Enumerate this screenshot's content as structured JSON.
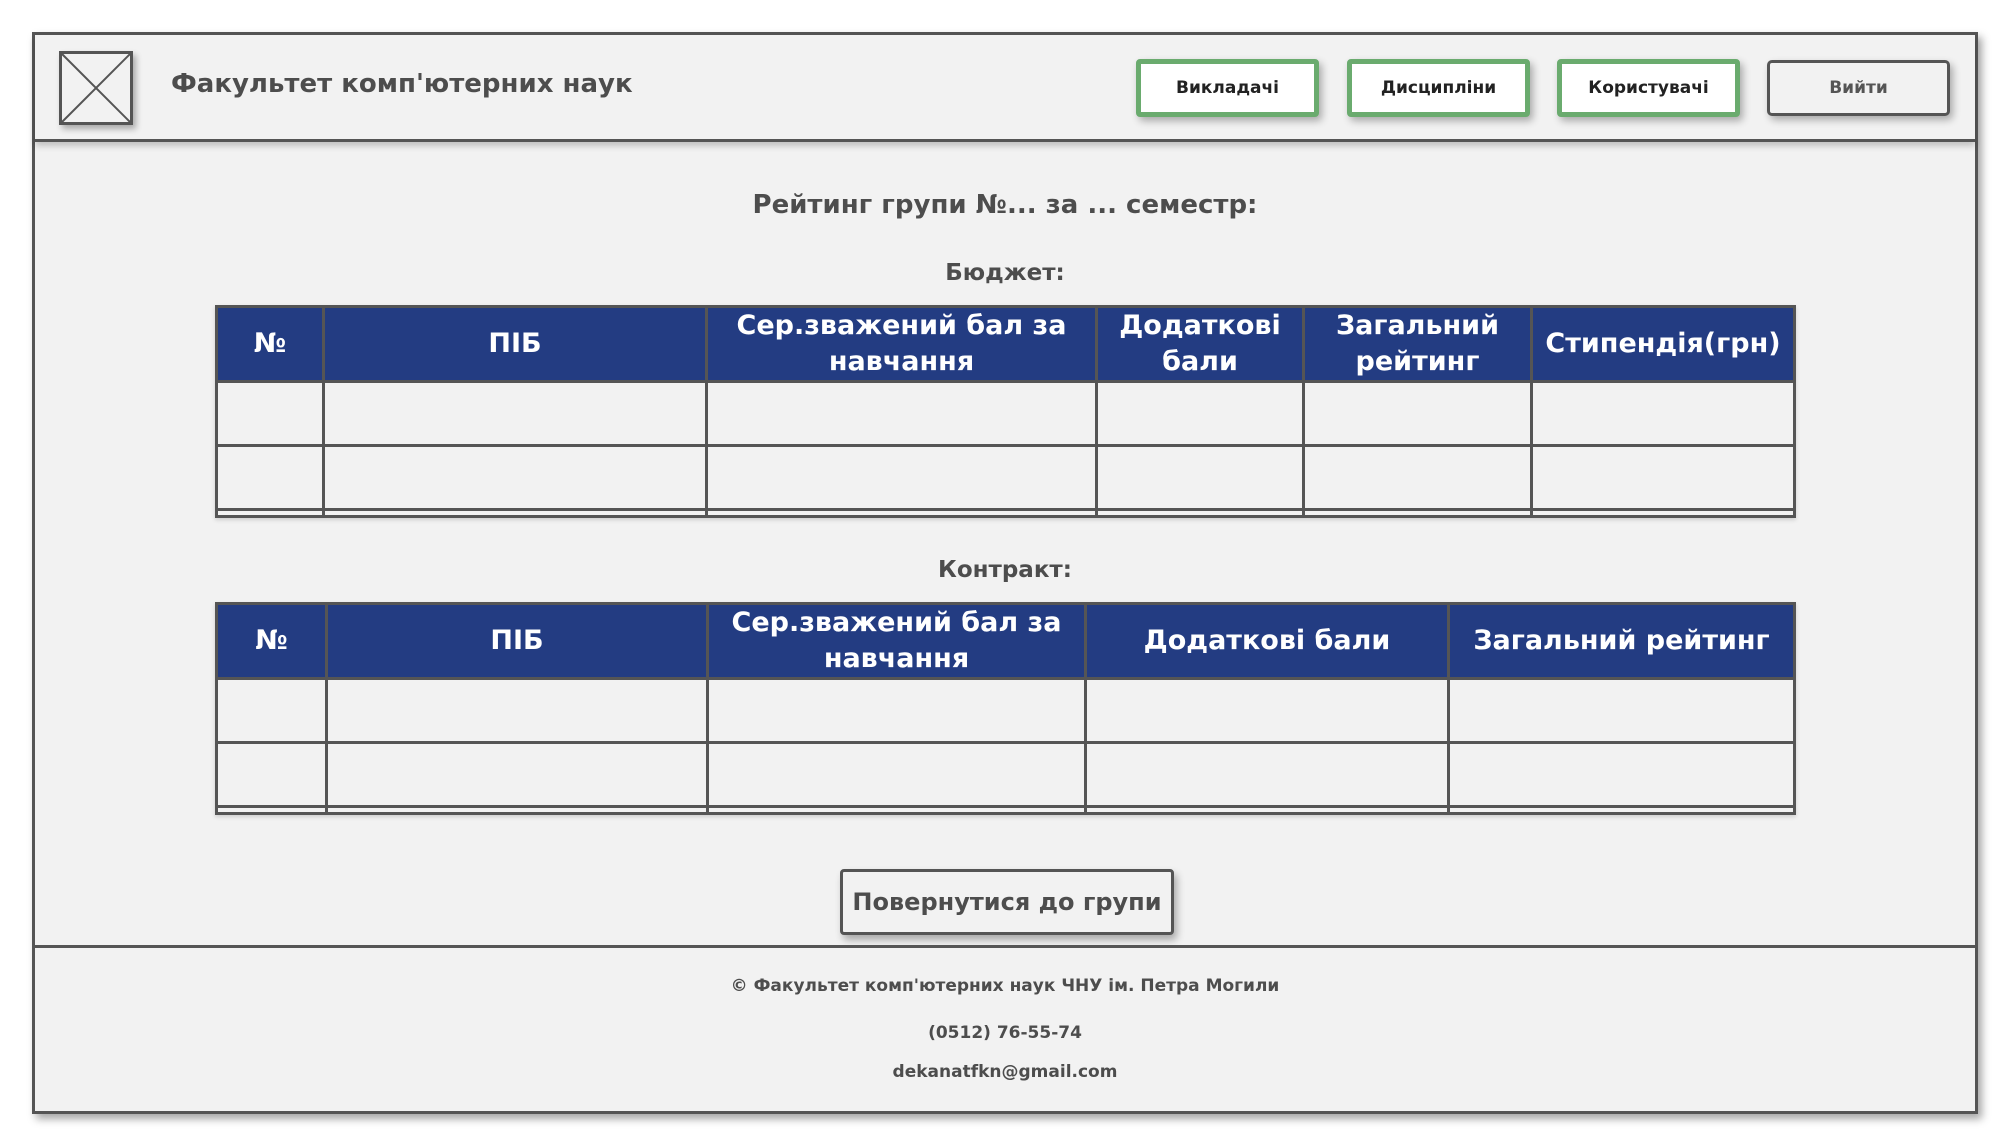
{
  "header": {
    "title": "Факультет комп'ютерних наук",
    "nav": [
      "Викладачі",
      "Дисципліни",
      "Користувачі"
    ],
    "logout_label": "Вийти"
  },
  "main": {
    "heading": "Рейтинг групи №... за ... семестр:",
    "budget": {
      "label": "Бюджет:",
      "columns": [
        "№",
        "ПІБ",
        "Сер.зважений бал за навчання",
        "Додаткові бали",
        "Загальний рейтинг",
        "Стипендія(грн)"
      ],
      "rows": [
        [
          "",
          "",
          "",
          "",
          "",
          ""
        ],
        [
          "",
          "",
          "",
          "",
          "",
          ""
        ]
      ]
    },
    "contract": {
      "label": "Контракт:",
      "columns": [
        "№",
        "ПІБ",
        "Сер.зважений бал за навчання",
        "Додаткові бали",
        "Загальний рейтинг"
      ],
      "rows": [
        [
          "",
          "",
          "",
          "",
          ""
        ],
        [
          "",
          "",
          "",
          "",
          ""
        ]
      ]
    },
    "back_label": "Повернутися до групи"
  },
  "footer": {
    "copyright": "© Факультет комп'ютерних наук ЧНУ ім. Петра Могили",
    "phone": "(0512) 76-55-74",
    "email": "dekanatfkn@gmail.com"
  },
  "colors": {
    "table_header": "#233c82",
    "nav_border": "#6aab6e",
    "frame_border": "#555555",
    "background": "#f2f2f2"
  }
}
